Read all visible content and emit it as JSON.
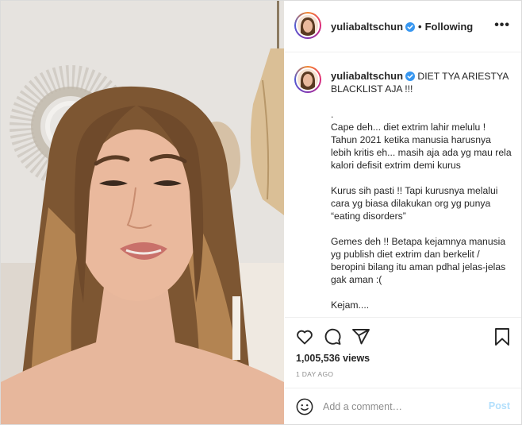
{
  "post": {
    "username": "yuliabaltschun",
    "follow_status": "Following",
    "more_icon": "more-horizontal-icon",
    "caption_title": "DIET TYA ARIESTYA BLACKLIST AJA !!!",
    "caption_paragraphs": [
      ".",
      "Cape deh... diet extrim lahir melulu ! Tahun 2021 ketika manusia harusnya lebih kritis eh... masih aja ada yg mau rela kalori defisit extrim demi kurus",
      "Kurus sih pasti !! Tapi kurusnya melalui cara yg biasa dilakukan org yg punya “eating disorders”",
      "Gemes deh !! Betapa kejamnya manusia yg publish diet extrim dan berkelit / beropini bilang itu aman pdhal jelas-jelas gak aman :(",
      "Kejam...."
    ],
    "views": "1,005,536 views",
    "timestamp": "1 DAY AGO"
  },
  "comment": {
    "placeholder": "Add a comment…",
    "post_label": "Post"
  },
  "colors": {
    "verified": "#3897f0",
    "post_disabled": "#b2dffc",
    "muted": "#8e8e8e"
  }
}
